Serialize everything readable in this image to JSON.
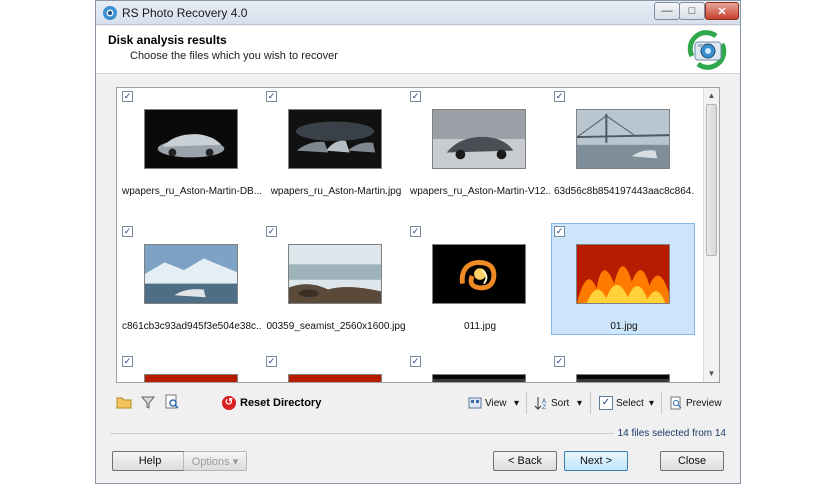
{
  "window": {
    "title": "RS Photo Recovery 4.0",
    "controls": {
      "minimize": "—",
      "maximize": "□",
      "close": "✕"
    }
  },
  "header": {
    "title": "Disk analysis results",
    "subtitle": "Choose the files which you wish to recover"
  },
  "files": [
    {
      "name": "wpapers_ru_Aston-Martin-DB...",
      "checked": true,
      "selected": false,
      "thumb": "car-silver"
    },
    {
      "name": "wpapers_ru_Aston-Martin.jpg",
      "checked": true,
      "selected": false,
      "thumb": "cars-dark"
    },
    {
      "name": "wpapers_ru_Aston-Martin-V12...",
      "checked": true,
      "selected": false,
      "thumb": "car-grey"
    },
    {
      "name": "63d56c8b854197443aac8c864...",
      "checked": true,
      "selected": false,
      "thumb": "bridge"
    },
    {
      "name": "c861cb3c93ad945f3e504e38c...",
      "checked": true,
      "selected": false,
      "thumb": "glacier"
    },
    {
      "name": "00359_seamist_2560x1600.jpg",
      "checked": true,
      "selected": false,
      "thumb": "seamist"
    },
    {
      "name": "011.jpg",
      "checked": true,
      "selected": false,
      "thumb": "fire-swirl"
    },
    {
      "name": "01.jpg",
      "checked": true,
      "selected": true,
      "thumb": "fire"
    },
    {
      "name": "",
      "checked": true,
      "selected": false,
      "thumb": "fire"
    },
    {
      "name": "",
      "checked": true,
      "selected": false,
      "thumb": "fire"
    },
    {
      "name": "",
      "checked": true,
      "selected": false,
      "thumb": "dark"
    },
    {
      "name": "",
      "checked": true,
      "selected": false,
      "thumb": "dark"
    }
  ],
  "checkmark": "✓",
  "toolbar": {
    "reset_label": "Reset Directory",
    "view_label": "View",
    "sort_label": "Sort",
    "select_label": "Select",
    "preview_label": "Preview",
    "dropdown_arrow": "▾"
  },
  "status": "14 files selected from 14",
  "buttons": {
    "help": "Help",
    "options": "Options ▾",
    "back": "< Back",
    "next": "Next >",
    "close": "Close"
  },
  "scroll": {
    "up": "▲",
    "down": "▼"
  }
}
